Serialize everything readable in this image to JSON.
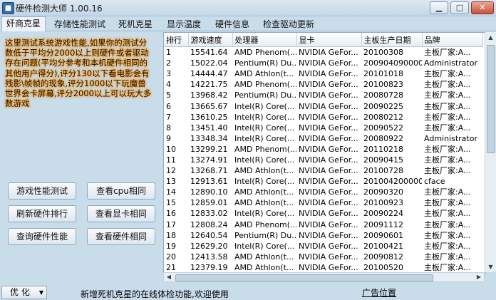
{
  "window": {
    "title": "硬件检测大师 1.00.16",
    "icon": "app-icon",
    "minimize": "▁",
    "maximize": "□",
    "close": "✕"
  },
  "tabs": [
    {
      "label": "奸商克星",
      "active": true
    },
    {
      "label": "存储性能测试"
    },
    {
      "label": "死机克星"
    },
    {
      "label": "显示温度"
    },
    {
      "label": "硬件信息"
    },
    {
      "label": "检查驱动更新"
    }
  ],
  "notice": "这里测试系统游戏性能,如果你的测试分数低于平均分2000以上则硬件或者驱动存在问题(平均分参考和本机硬件相同的其他用户得分),评分130以下看电影会有残影\\帧帧的现象,评分1000以下玩魔兽世界会卡屏幕,评分2000以上可以玩大多数游戏",
  "buttons": {
    "game_test": "游戏性能测试",
    "view_cpu": "查看cpu相同",
    "refresh_rank": "刷新硬件排行",
    "view_gpu": "查看显卡相同",
    "query_perf": "查询硬件性能",
    "view_hw": "查看硬件相同"
  },
  "table": {
    "headers": [
      "排行",
      "游戏速度",
      "处理器",
      "显卡",
      "主板生产日期",
      "品牌"
    ],
    "rows": [
      [
        "1",
        "15541.64",
        "AMD Phenom(...",
        "NVIDIA GeFor...",
        "20100308",
        "主板厂家:A..."
      ],
      [
        "2",
        "15022.04",
        "Pentium(R) Du...",
        "NVIDIA GeFor...",
        "200904090000...",
        "Administrator"
      ],
      [
        "3",
        "14444.47",
        "AMD Athlon(t...",
        "NVIDIA GeFor...",
        "20101018",
        "主板厂家:A..."
      ],
      [
        "4",
        "14221.75",
        "AMD Phenom(...",
        "NVIDIA GeFor...",
        "20100823",
        "主板厂家:A..."
      ],
      [
        "5",
        "13968.42",
        "Pentium(R) Du...",
        "NVIDIA GeFor...",
        "20080728",
        "主板厂家:A..."
      ],
      [
        "6",
        "13665.67",
        "Intel(R) Core(...",
        "NVIDIA GeFor...",
        "20090225",
        "主板厂家:A..."
      ],
      [
        "7",
        "13610.25",
        "Intel(R) Core(...",
        "NVIDIA GeFor...",
        "20080212",
        "主板厂家:A..."
      ],
      [
        "8",
        "13451.40",
        "Intel(R) Core(...",
        "NVIDIA GeFor...",
        "20090522",
        "主板厂家:A..."
      ],
      [
        "9",
        "13348.34",
        "Intel(R) Core(...",
        "NVIDIA GeFor...",
        "20080922",
        "Administrator"
      ],
      [
        "10",
        "13299.21",
        "AMD Phenom(...",
        "NVIDIA GeFor...",
        "20110218",
        "主板厂家:A..."
      ],
      [
        "11",
        "13274.91",
        "Intel(R) Core(...",
        "NVIDIA GeFor...",
        "20090415",
        "主板厂家:A..."
      ],
      [
        "12",
        "13268.71",
        "AMD Athlon(t...",
        "NVIDIA GeFor...",
        "20100728",
        "主板厂家:A..."
      ],
      [
        "13",
        "12913.61",
        "Intel(R) Core(...",
        "NVIDIA GeFor...",
        "201004200000...",
        "cface"
      ],
      [
        "14",
        "12890.10",
        "AMD Athlon(t...",
        "NVIDIA GeFor...",
        "20090320",
        "主板厂家:A..."
      ],
      [
        "15",
        "12859.01",
        "AMD Athlon(t...",
        "NVIDIA GeFor...",
        "20100923",
        "主板厂家:A..."
      ],
      [
        "16",
        "12833.02",
        "Intel(R) Core(...",
        "NVIDIA GeFor...",
        "20090224",
        "主板厂家:A..."
      ],
      [
        "17",
        "12808.24",
        "AMD Phenom(...",
        "NVIDIA GeFor...",
        "20091112",
        "主板厂家:A..."
      ],
      [
        "18",
        "12640.54",
        "Pentium(R) Du...",
        "NVIDIA GeFor...",
        "20090601",
        "主板厂家:A..."
      ],
      [
        "19",
        "12629.20",
        "Intel(R) Core(...",
        "NVIDIA GeFor...",
        "20100421",
        "主板厂家:A..."
      ],
      [
        "20",
        "12413.58",
        "AMD Athlon(t...",
        "NVIDIA GeFor...",
        "20090812",
        "主板厂家:A..."
      ],
      [
        "21",
        "12379.19",
        "AMD Athlon(t...",
        "NVIDIA GeFor...",
        "20100520",
        "主板厂家:A..."
      ]
    ]
  },
  "status": {
    "optimize": "优 化",
    "message": "新增死机克星的在线体检功能,欢迎使用",
    "ad_link": "广告位置"
  }
}
